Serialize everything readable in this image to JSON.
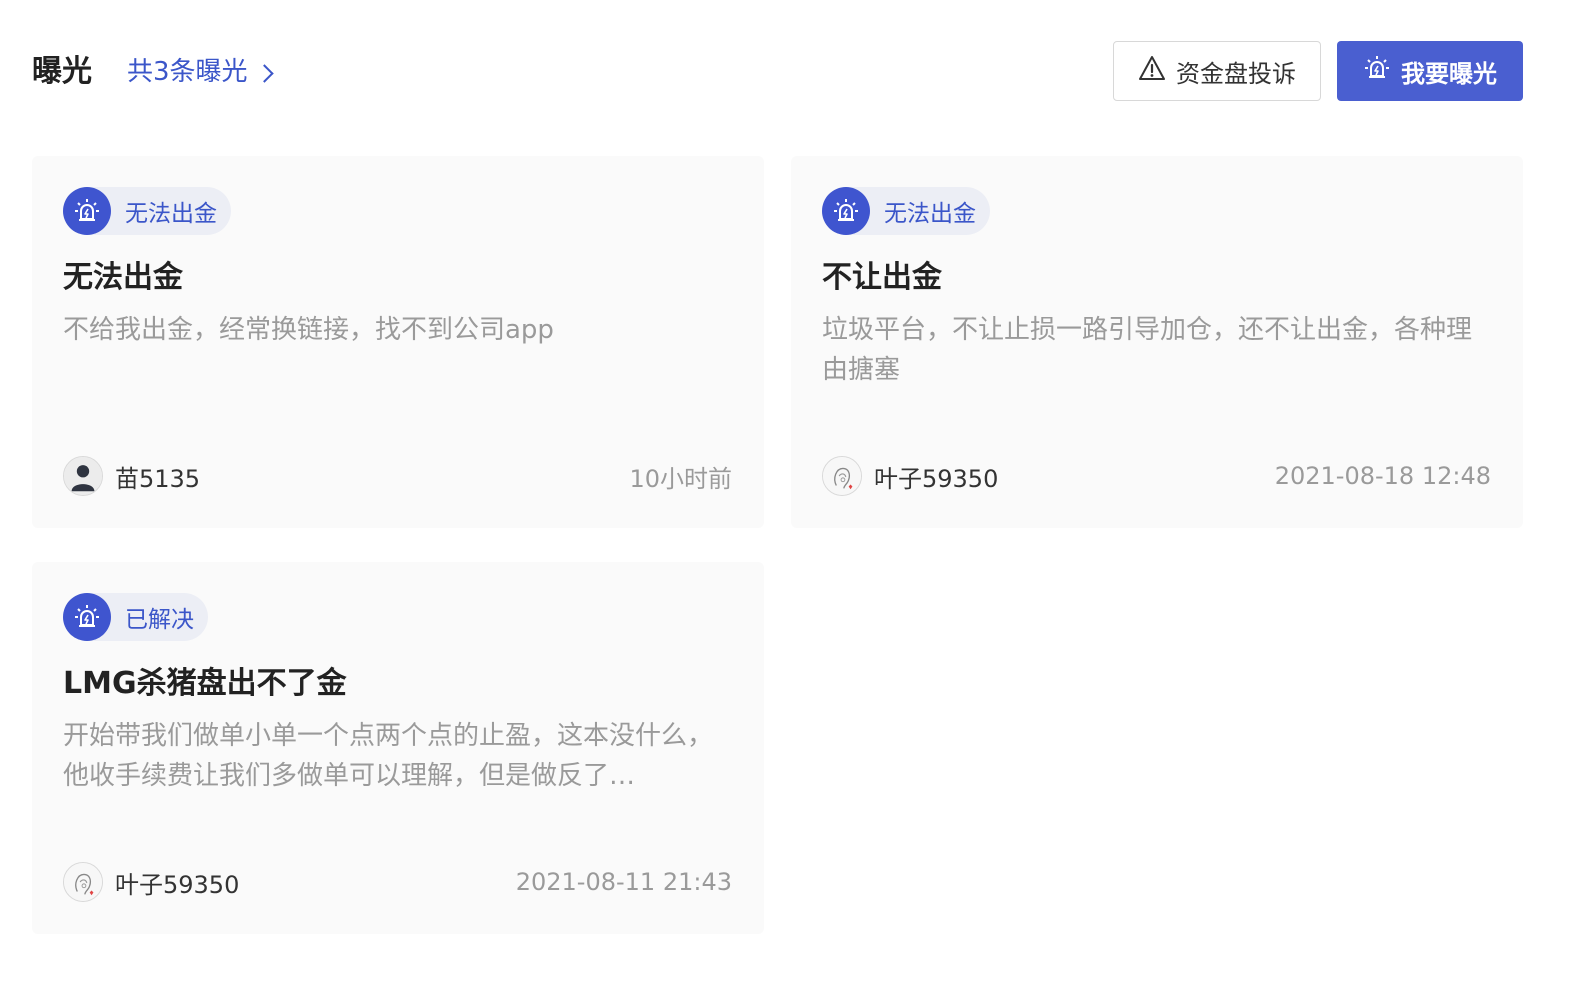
{
  "header": {
    "title": "曝光",
    "count_label": "共3条曝光",
    "complain_button": "资金盘投诉",
    "expose_button": "我要曝光"
  },
  "colors": {
    "accent": "#4a5fd0",
    "link": "#3b56c9",
    "card_bg": "#fafafa"
  },
  "cards": [
    {
      "tag": "无法出金",
      "tag_icon": "alarm-icon",
      "title": "无法出金",
      "description": "不给我出金，经常换链接，找不到公司app",
      "user": "苗5135",
      "avatar": "default-person-avatar",
      "time": "10小时前"
    },
    {
      "tag": "无法出金",
      "tag_icon": "alarm-icon",
      "title": "不让出金",
      "description": "垃圾平台，不让止损一路引导加仓，还不让出金，各种理由搪塞",
      "user": "叶子59350",
      "avatar": "sketch-avatar",
      "time": "2021-08-18 12:48"
    },
    {
      "tag": "已解决",
      "tag_icon": "alarm-icon",
      "title": "LMG杀猪盘出不了金",
      "description": "开始带我们做单小单一个点两个点的止盈，这本没什么，他收手续费让我们多做单可以理解，但是做反了…",
      "user": "叶子59350",
      "avatar": "sketch-avatar",
      "time": "2021-08-11 21:43"
    }
  ]
}
